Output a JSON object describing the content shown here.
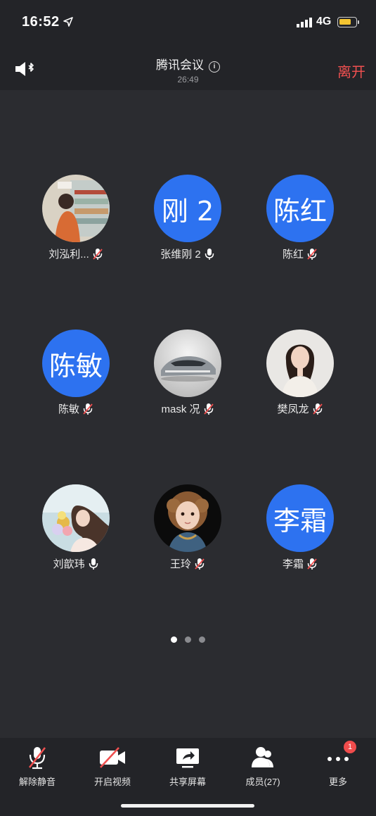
{
  "status_bar": {
    "time": "16:52",
    "network": "4G"
  },
  "header": {
    "title": "腾讯会议",
    "duration": "26:49",
    "leave_label": "离开"
  },
  "participants": [
    {
      "name": "刘泓利...",
      "avatar_type": "photo",
      "mic": "muted"
    },
    {
      "name": "张维刚 2",
      "avatar_type": "text",
      "avatar_text": "刚 2",
      "mic": "on"
    },
    {
      "name": "陈红",
      "avatar_type": "text",
      "avatar_text": "陈红",
      "mic": "muted"
    },
    {
      "name": "陈敏",
      "avatar_type": "text",
      "avatar_text": "陈敏",
      "mic": "muted"
    },
    {
      "name": "mask 况",
      "avatar_type": "photo",
      "mic": "muted"
    },
    {
      "name": "樊凤龙",
      "avatar_type": "photo",
      "mic": "muted"
    },
    {
      "name": "刘歆玮",
      "avatar_type": "photo",
      "mic": "on"
    },
    {
      "name": "王玲",
      "avatar_type": "photo",
      "mic": "muted"
    },
    {
      "name": "李霜",
      "avatar_type": "text",
      "avatar_text": "李霜",
      "mic": "muted"
    }
  ],
  "pagination": {
    "total": 3,
    "current": 1
  },
  "toolbar": {
    "unmute": "解除静音",
    "start_video": "开启视频",
    "share_screen": "共享屏幕",
    "members": "成员(27)",
    "more": "更多",
    "more_badge": "1"
  },
  "colors": {
    "accent_blue": "#2d72f0",
    "leave_red": "#f05050",
    "background": "#2b2c30",
    "bar": "#232428"
  }
}
